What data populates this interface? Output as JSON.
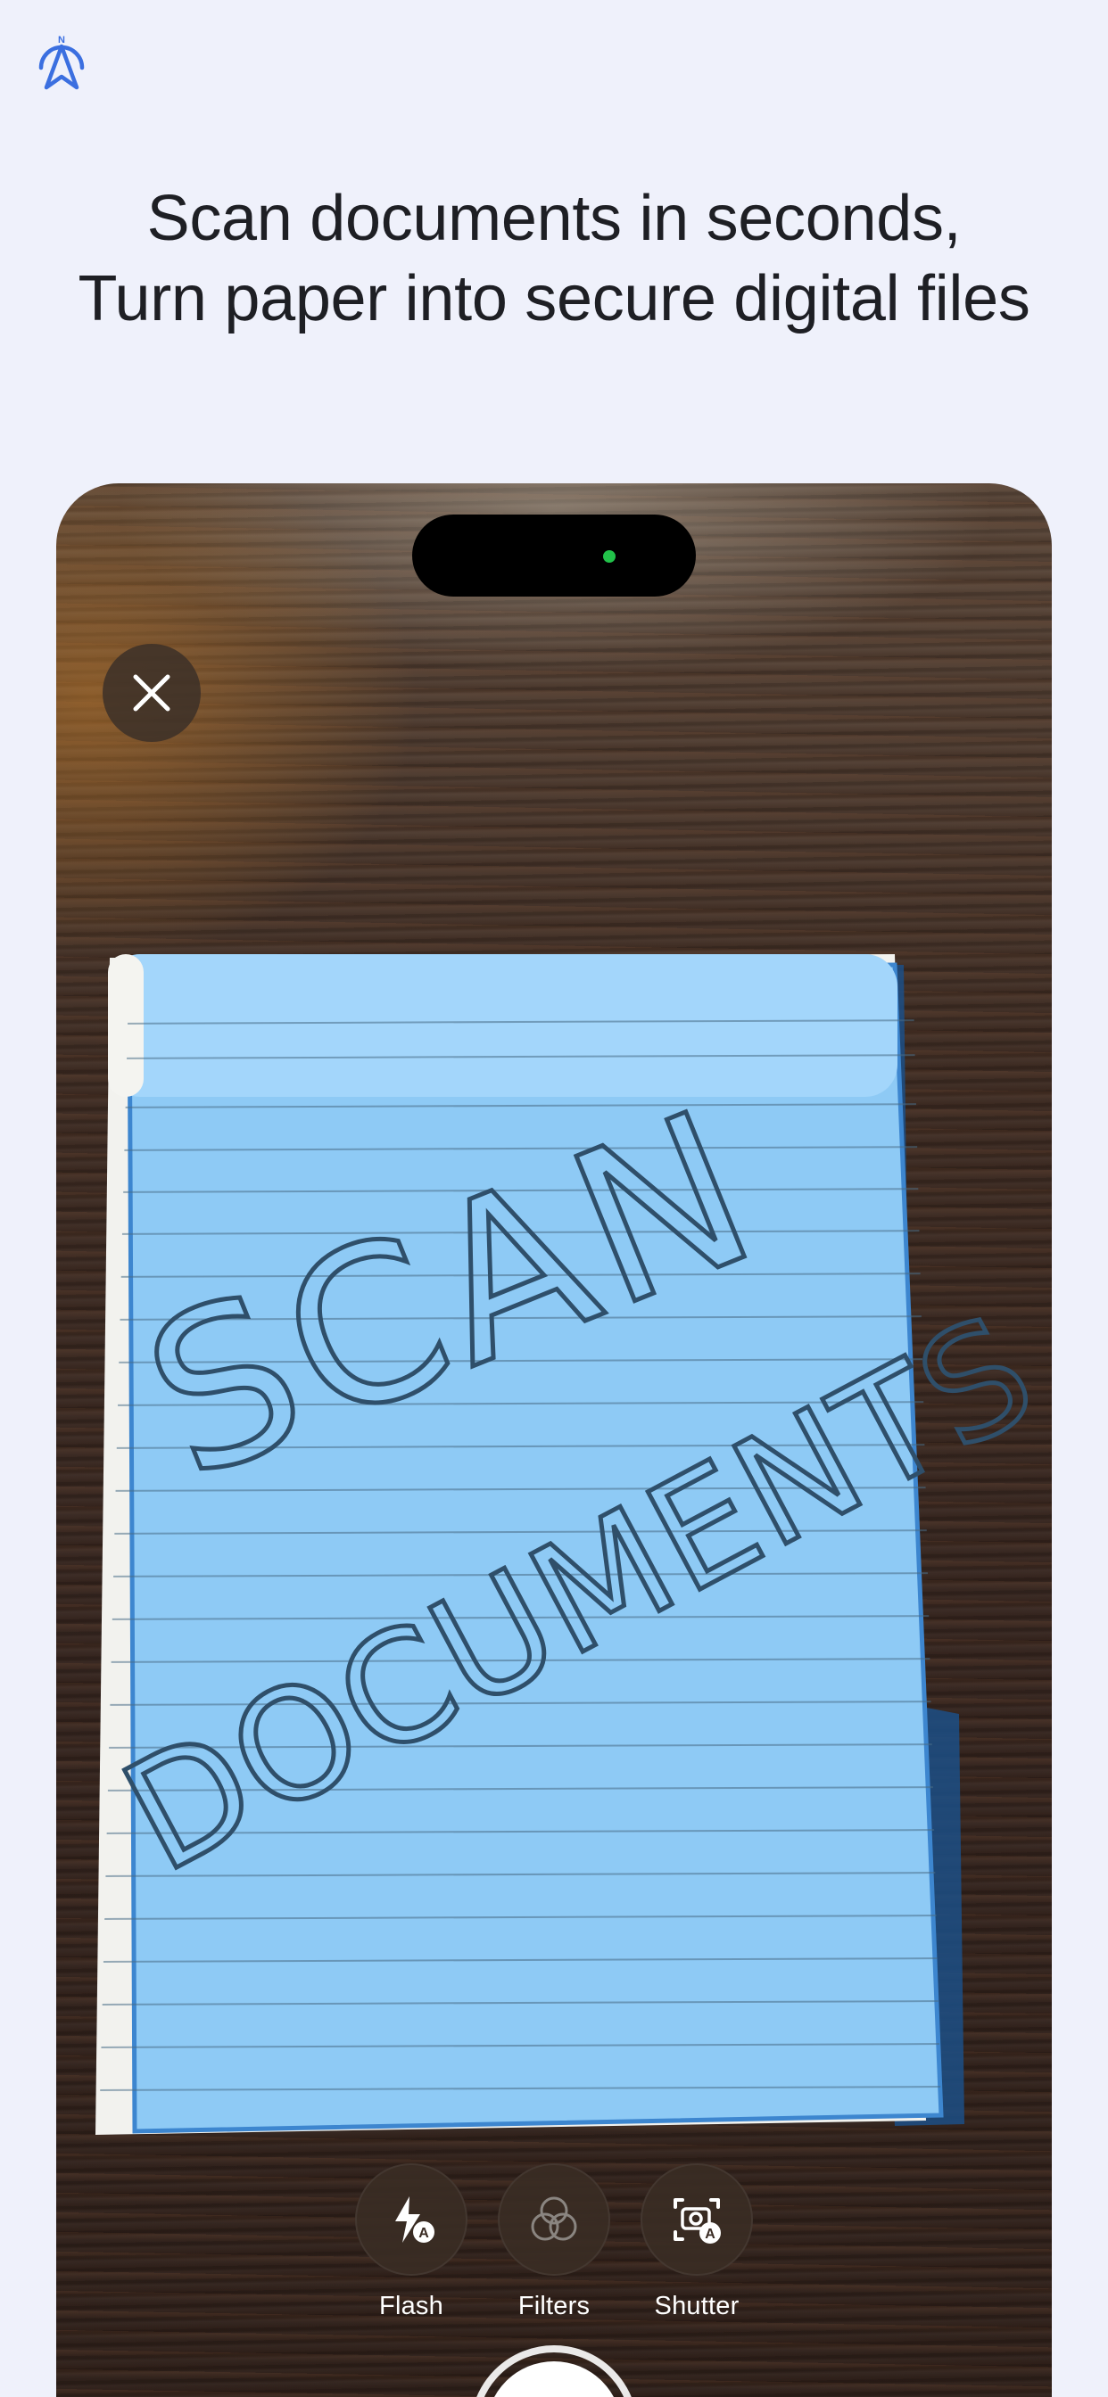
{
  "headline": {
    "line1": "Scan documents in seconds,",
    "line2": "Turn paper into secure digital files"
  },
  "logo": {
    "icon": "compass-logo-icon",
    "color": "#3b6fe0"
  },
  "camera": {
    "close_icon": "close-icon",
    "document_text_line1": "SCAN",
    "document_text_line2": "DOCUMENTS",
    "detection_overlay_color": "#8ecaf5",
    "camera_indicator_color": "#22c24a",
    "controls": [
      {
        "label": "Flash",
        "icon": "flash-auto-icon"
      },
      {
        "label": "Filters",
        "icon": "filters-icon"
      },
      {
        "label": "Shutter",
        "icon": "auto-shutter-icon"
      }
    ]
  }
}
